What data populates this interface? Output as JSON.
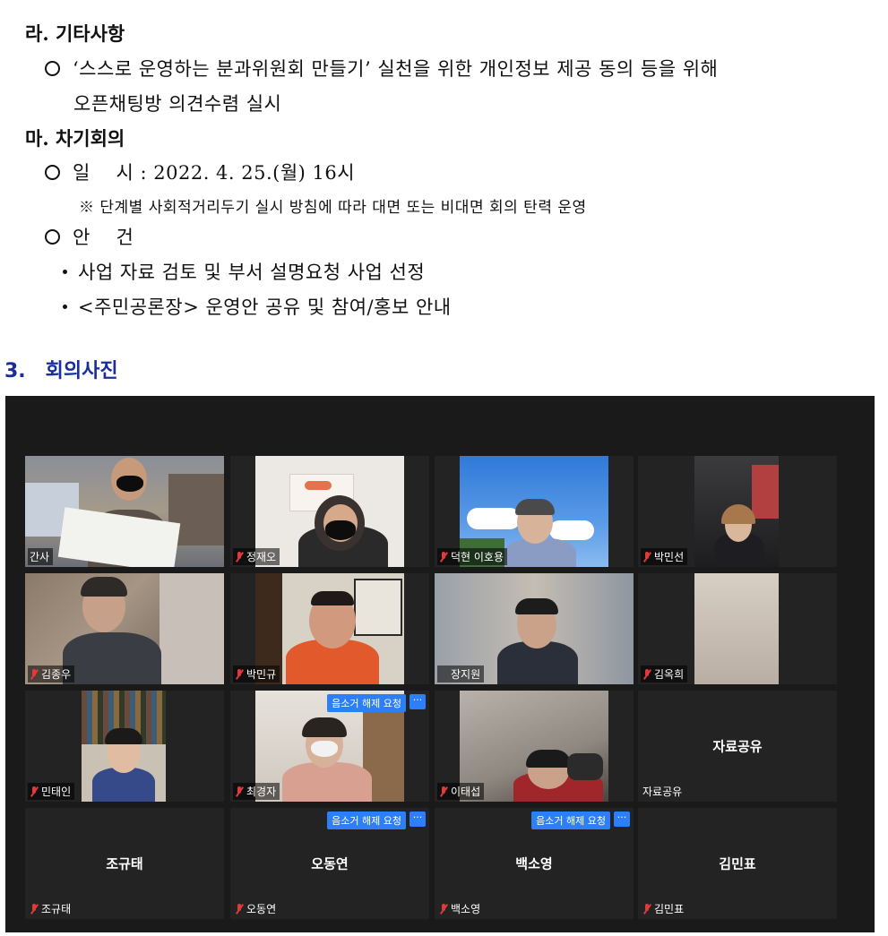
{
  "doc": {
    "h_ra": "라. 기타사항",
    "ra_item1_line1": "‘스스로 운영하는 분과위원회 만들기’ 실천을 위한 개인정보 제공 동의 등을 위해",
    "ra_item1_line2": "오픈채팅방 의견수렴 실시",
    "h_ma": "마. 차기회의",
    "date_item": "일    시 : 2022. 4. 25.(월) 16시",
    "date_note": "※ 단계별 사회적거리두기 실시 방침에 따라 대면 또는 비대면 회의 탄력 운영",
    "agenda_item": "안    건",
    "agenda_1": "사업 자료 검토 및 부서 설명요청 사업 선정",
    "agenda_2": "<주민공론장> 운영안 공유 및 참여/홍보 안내",
    "section_num": "3.",
    "section_title": "회의사진"
  },
  "zoom": {
    "request_label": "음소거 해제 요청",
    "more_label": "···",
    "participants": [
      {
        "name": "간사",
        "muted": false,
        "video": true,
        "active": true
      },
      {
        "name": "정재오",
        "muted": true,
        "video": true
      },
      {
        "name": "덕현 이호용",
        "muted": true,
        "video": true
      },
      {
        "name": "박민선",
        "muted": true,
        "video": true
      },
      {
        "name": "김종우",
        "muted": true,
        "video": true
      },
      {
        "name": "박민규",
        "muted": true,
        "video": true
      },
      {
        "name": "장지원",
        "muted": false,
        "video": true
      },
      {
        "name": "김옥희",
        "muted": true,
        "video": true
      },
      {
        "name": "민태인",
        "muted": true,
        "video": true
      },
      {
        "name": "최경자",
        "muted": true,
        "video": true,
        "request": true
      },
      {
        "name": "이태섭",
        "muted": true,
        "video": true
      },
      {
        "name": "자료공유",
        "muted": false,
        "video": false,
        "center": "자료공유"
      },
      {
        "name": "조규태",
        "muted": true,
        "video": false,
        "center": "조규태"
      },
      {
        "name": "오동연",
        "muted": true,
        "video": false,
        "center": "오동연",
        "request": true
      },
      {
        "name": "백소영",
        "muted": true,
        "video": false,
        "center": "백소영",
        "request": true
      },
      {
        "name": "김민표",
        "muted": true,
        "video": false,
        "center": "김민표"
      }
    ]
  }
}
